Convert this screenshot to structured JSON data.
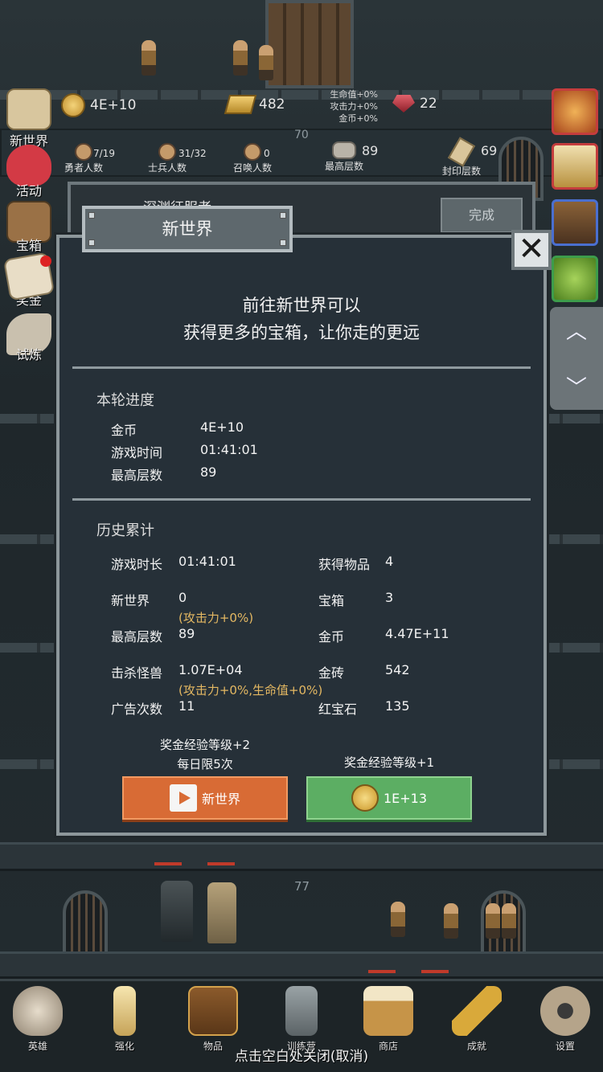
{
  "top_stats": {
    "coins": "4E+10",
    "gold": "482",
    "ruby": "22",
    "bonus_lines": [
      "生命值+0%",
      "攻击力+0%",
      "金币+0%"
    ],
    "floor_indicator": "70"
  },
  "counts": [
    {
      "value": "7/19",
      "label": "勇者人数"
    },
    {
      "value": "31/32",
      "label": "士兵人数"
    },
    {
      "value": "0",
      "label": "召唤人数"
    },
    {
      "value": "89",
      "label": "最高层数"
    },
    {
      "value": "69",
      "label": "封印层数"
    }
  ],
  "left_menu": [
    "新世界",
    "活动",
    "宝箱",
    "奖金",
    "试炼"
  ],
  "quest": {
    "title": "深渊征服者",
    "button": "完成"
  },
  "dialog": {
    "title": "新世界",
    "headline1": "前往新世界可以",
    "headline2": "获得更多的宝箱，让你走的更远",
    "round": {
      "section": "本轮进度",
      "rows": [
        {
          "label": "金币",
          "value": "4E+10"
        },
        {
          "label": "游戏时间",
          "value": "01:41:01"
        },
        {
          "label": "最高层数",
          "value": "89"
        }
      ]
    },
    "history": {
      "section": "历史累计",
      "left": [
        {
          "label": "游戏时长",
          "value": "01:41:01"
        },
        {
          "label": "新世界",
          "value": "0"
        },
        {
          "label": "最高层数",
          "value": "89"
        },
        {
          "label": "击杀怪兽",
          "value": "1.07E+04"
        },
        {
          "label": "广告次数",
          "value": "11"
        }
      ],
      "right": [
        {
          "label": "获得物品",
          "value": "4"
        },
        {
          "label": "宝箱",
          "value": "3"
        },
        {
          "label": "金币",
          "value": "4.47E+11"
        },
        {
          "label": "金砖",
          "value": "542"
        },
        {
          "label": "红宝石",
          "value": "135"
        }
      ],
      "note1": "(攻击力+0%)",
      "note2": "(攻击力+0%,生命值+0%)"
    },
    "left_caption1": "奖金经验等级+2",
    "left_caption2": "每日限5次",
    "right_caption": "奖金经验等级+1",
    "ad_button": "新世界",
    "coin_button": "1E+13"
  },
  "scene": {
    "floor_label": "77"
  },
  "bottom_nav": [
    "英雄",
    "强化",
    "物品",
    "训练营",
    "商店",
    "成就",
    "设置"
  ],
  "close_hint": "点击空白处关闭(取消)"
}
